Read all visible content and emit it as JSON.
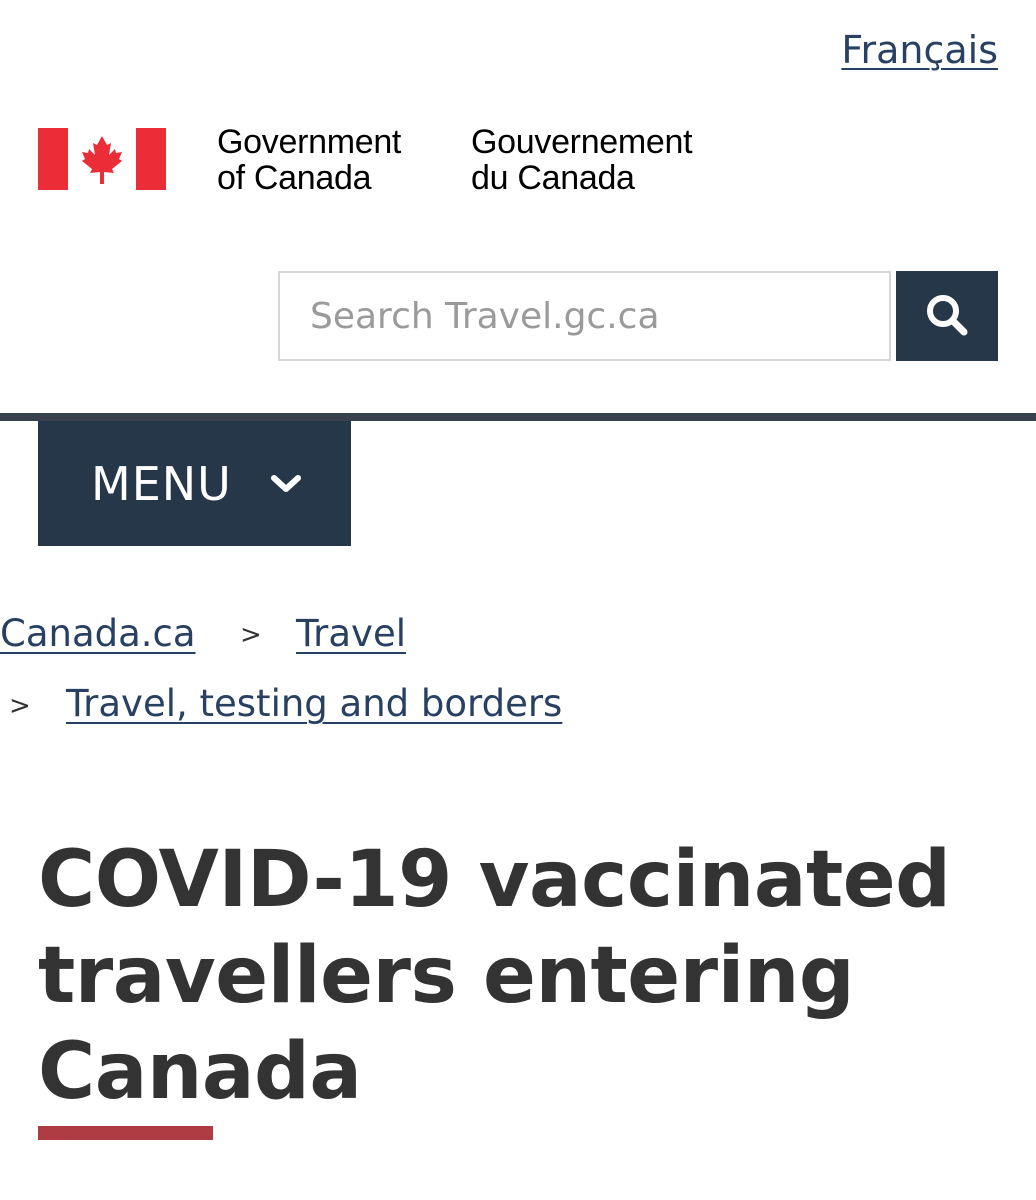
{
  "header": {
    "language_link": "Français",
    "gov_name_en_line1": "Government",
    "gov_name_en_line2": "of Canada",
    "gov_name_fr_line1": "Gouvernement",
    "gov_name_fr_line2": "du Canada"
  },
  "search": {
    "placeholder": "Search Travel.gc.ca",
    "button_icon": "search-icon"
  },
  "menu": {
    "label": "MENU",
    "icon": "chevron-down-icon"
  },
  "breadcrumb": {
    "items": [
      {
        "label": "Canada.ca"
      },
      {
        "label": "Travel"
      },
      {
        "label": "Travel, testing and borders"
      }
    ],
    "separator": ">"
  },
  "page": {
    "title_line1": "COVID-19 vaccinated",
    "title_line2": "travellers entering",
    "title_line3": "Canada"
  },
  "colors": {
    "link": "#284162",
    "dark_blue": "#26374a",
    "flag_red": "#eb2d37",
    "title_accent": "#af3c43"
  }
}
